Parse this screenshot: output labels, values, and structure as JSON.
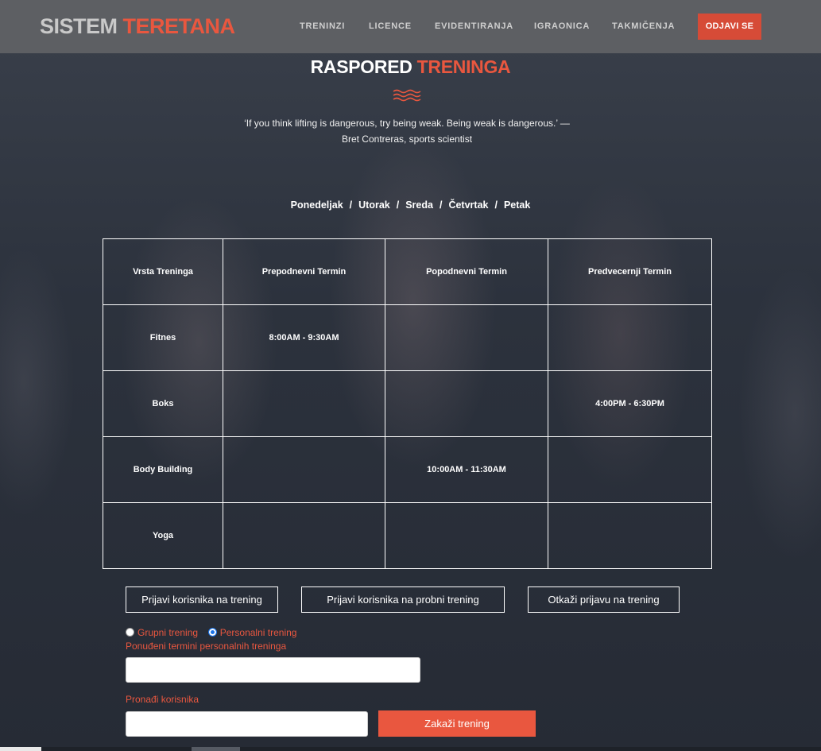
{
  "brand": {
    "part1": "SISTEM",
    "part2": "TERETANA"
  },
  "nav": {
    "items": [
      "TRENINZI",
      "LICENCE",
      "EVIDENTIRANJA",
      "IGRAONICA",
      "TAKMIČENJA"
    ],
    "logout": "ODJAVI SE"
  },
  "heading": {
    "part1": "RASPORED",
    "part2": "TRENINGA"
  },
  "quote": "‘If you think lifting is dangerous, try being weak. Being weak is dangerous.’ — Bret Contreras, sports scientist",
  "days": [
    "Ponedeljak",
    "Utorak",
    "Sreda",
    "Četvrtak",
    "Petak"
  ],
  "day_separator": "/",
  "table": {
    "headers": [
      "Vrsta Treninga",
      "Prepodnevni Termin",
      "Popodnevni Termin",
      "Predvecernji Termin"
    ],
    "rows": [
      [
        "Fitnes",
        "8:00AM - 9:30AM",
        "",
        ""
      ],
      [
        "Boks",
        "",
        "",
        "4:00PM - 6:30PM"
      ],
      [
        "Body Building",
        "",
        "10:00AM - 11:30AM",
        ""
      ],
      [
        "Yoga",
        "",
        "",
        ""
      ]
    ]
  },
  "actions": {
    "register": "Prijavi korisnika na trening",
    "trial": "Prijavi korisnika na probni trening",
    "cancel": "Otkaži prijavu na trening"
  },
  "training_type": {
    "group": "Grupni trening",
    "personal": "Personalni trening",
    "selected": "Personalni trening"
  },
  "offered_label": "Ponuđeni termini personalnih treninga",
  "offered_value": "",
  "find_user_label": "Pronađi korisnika",
  "find_user_value": "",
  "schedule_button": "Zakaži trening",
  "colors": {
    "accent": "#e9573f",
    "navbar": "#5d5f63",
    "logout_bg": "#d64b37"
  }
}
